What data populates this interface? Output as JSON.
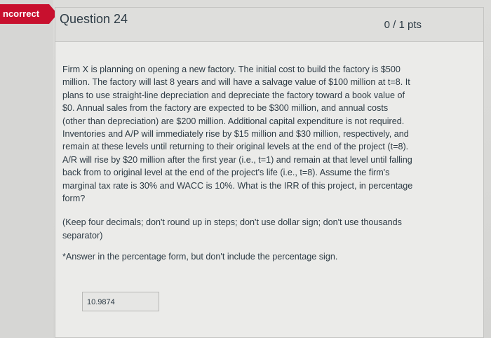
{
  "banner": {
    "label": "ncorrect"
  },
  "question": {
    "title": "Question 24",
    "points": "0 / 1 pts",
    "text": "Firm X is planning on opening a new factory. The initial cost to build the factory is $500 million. The factory will last 8 years and will have a salvage value of $100 million at t=8. It plans to use straight-line depreciation and depreciate the factory toward a book value of $0. Annual sales from the factory are expected to be $300 million, and annual costs (other than depreciation) are $200 million. Additional capital expenditure is not required. Inventories and A/P will immediately rise by $15 million and $30 million, respectively, and remain at these levels until returning to their original levels at the end of the project (t=8). A/R will rise by $20 million after the first year (i.e., t=1) and remain at that level until falling back from to original level at the end of the project's life (i.e., t=8). Assume the firm's marginal tax rate is 30% and WACC is 10%. What is the IRR of this project, in percentage form?",
    "note": "(Keep four decimals; don't round up in steps; don't use dollar sign; don't use thousands separator)",
    "answer_note": "*Answer in the percentage form, but don't include the percentage sign.",
    "answer_value": "10.9874"
  },
  "colors": {
    "banner": "#c8102e",
    "text": "#2d3b45"
  }
}
